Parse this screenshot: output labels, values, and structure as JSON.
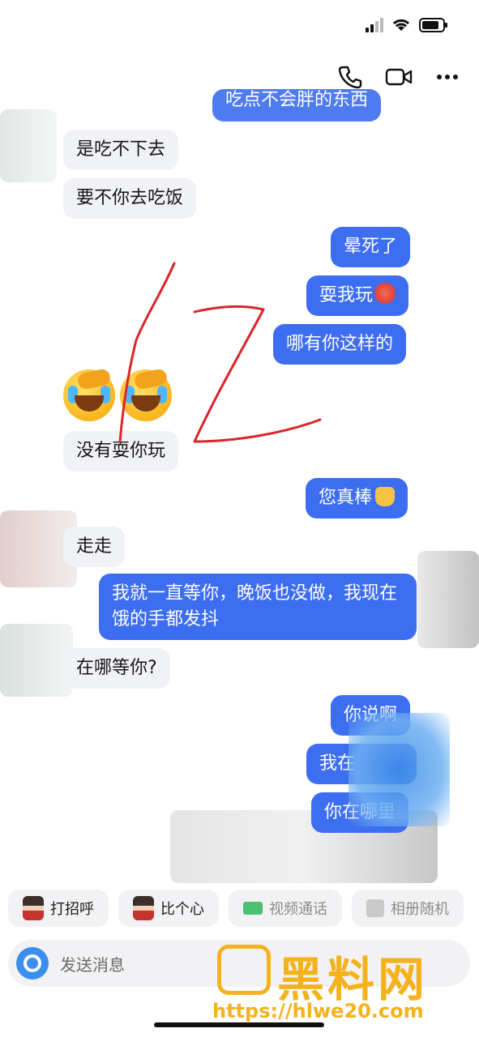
{
  "top_actions": {
    "icons": [
      "phone-icon",
      "video-call-icon",
      "more-icon"
    ]
  },
  "messages": {
    "m0": "吃点不会胖的东西",
    "m1": "是吃不下去",
    "m2": "要不你去吃饭",
    "m3": "晕死了",
    "m4": "耍我玩",
    "m5": "哪有你这样的",
    "m6": "没有耍你玩",
    "m7": "您真棒",
    "m8": "走走",
    "m9": "我就一直等你，晚饭也没做，我现在饿的手都发抖",
    "m10": "在哪等你?",
    "m11": "你说啊",
    "m12": "我在",
    "m13": "你在哪里"
  },
  "chips": [
    {
      "label": "打招呼"
    },
    {
      "label": "比个心"
    },
    {
      "label": "视频通话"
    },
    {
      "label": "相册随机"
    }
  ],
  "input": {
    "placeholder": "发送消息"
  },
  "watermark": {
    "title": "黑料网",
    "url": "https://hlwe20.com"
  },
  "colors": {
    "sent_bubble": "#3d6df0",
    "received_bubble": "#f1f2f6",
    "watermark": "#f5b21c",
    "scribble": "#d9262b"
  }
}
